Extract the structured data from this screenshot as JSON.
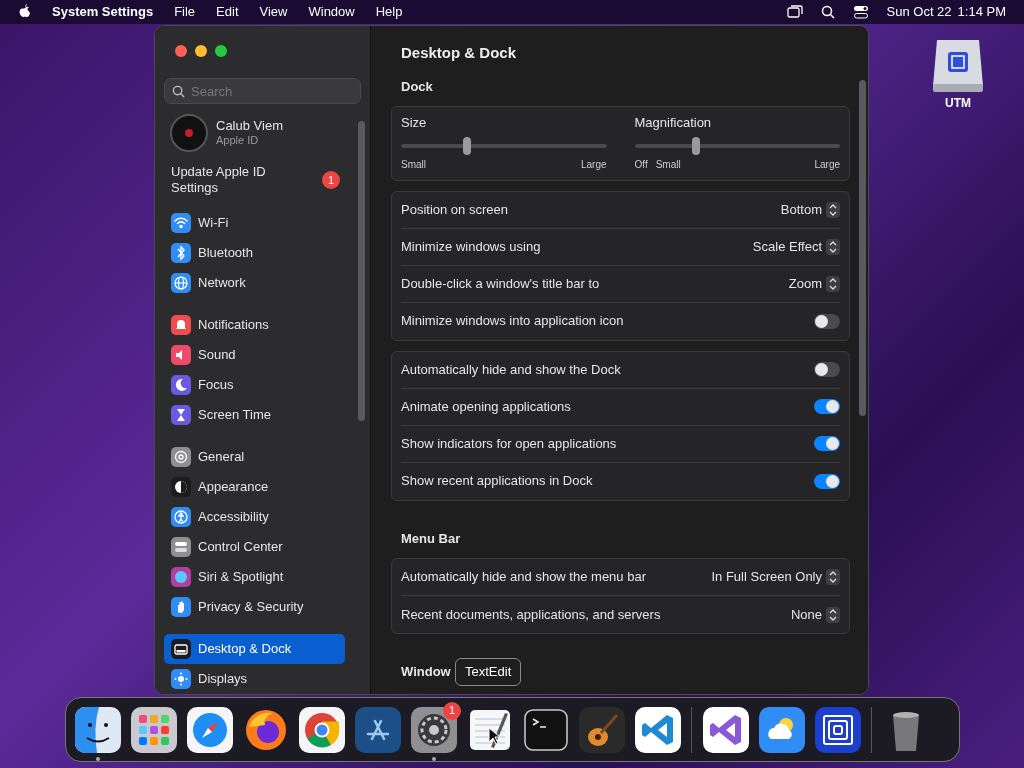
{
  "menu_bar": {
    "app_name": "System Settings",
    "menus": [
      "File",
      "Edit",
      "View",
      "Window",
      "Help"
    ],
    "date": "Sun Oct 22",
    "time": "1:14 PM"
  },
  "desktop_icon": {
    "label": "UTM"
  },
  "window": {
    "title": "Desktop & Dock",
    "sidebar": {
      "search": {
        "placeholder": "Search"
      },
      "account": {
        "name": "Calub Viem",
        "subtitle": "Apple ID"
      },
      "notice": {
        "text": "Update Apple ID Settings",
        "badge": "1"
      },
      "groups": [
        [
          {
            "label": "Wi-Fi",
            "selected": false
          },
          {
            "label": "Bluetooth",
            "selected": false
          },
          {
            "label": "Network",
            "selected": false
          }
        ],
        [
          {
            "label": "Notifications",
            "selected": false
          },
          {
            "label": "Sound",
            "selected": false
          },
          {
            "label": "Focus",
            "selected": false
          },
          {
            "label": "Screen Time",
            "selected": false
          }
        ],
        [
          {
            "label": "General",
            "selected": false
          },
          {
            "label": "Appearance",
            "selected": false
          },
          {
            "label": "Accessibility",
            "selected": false
          },
          {
            "label": "Control Center",
            "selected": false
          },
          {
            "label": "Siri & Spotlight",
            "selected": false
          },
          {
            "label": "Privacy & Security",
            "selected": false
          }
        ],
        [
          {
            "label": "Desktop & Dock",
            "selected": true
          },
          {
            "label": "Displays",
            "selected": false
          }
        ]
      ]
    },
    "sections": [
      {
        "title": "Dock",
        "sliders": [
          {
            "label": "Size",
            "level": 0.32,
            "ticks": [
              "Small",
              "Large"
            ]
          },
          {
            "label": "Magnification",
            "level": 0.3,
            "ticks": [
              "Small",
              "Large"
            ],
            "off_label": "Off"
          }
        ],
        "cards": [
          [
            {
              "kind": "select",
              "label": "Position on screen",
              "value": "Bottom"
            },
            {
              "kind": "select",
              "label": "Minimize windows using",
              "value": "Scale Effect"
            },
            {
              "kind": "select",
              "label": "Double-click a window's title bar to",
              "value": "Zoom"
            },
            {
              "kind": "toggle",
              "label": "Minimize windows into application icon",
              "on": false
            }
          ],
          [
            {
              "kind": "toggle",
              "label": "Automatically hide and show the Dock",
              "on": false
            },
            {
              "kind": "toggle",
              "label": "Animate opening applications",
              "on": true
            },
            {
              "kind": "toggle",
              "label": "Show indicators for open applications",
              "on": true
            },
            {
              "kind": "toggle",
              "label": "Show recent applications in Dock",
              "on": true
            }
          ]
        ]
      },
      {
        "title": "Menu Bar",
        "cards": [
          [
            {
              "kind": "select",
              "label": "Automatically hide and show the menu bar",
              "value": "In Full Screen Only"
            },
            {
              "kind": "select",
              "label": "Recent documents, applications, and servers",
              "value": "None"
            }
          ]
        ]
      },
      {
        "title": "Window"
      }
    ]
  },
  "dock": {
    "tooltip": "TextEdit",
    "groups": [
      [
        {
          "kind": "finder",
          "running": true
        },
        {
          "kind": "launchpad",
          "running": false
        },
        {
          "kind": "safari",
          "running": false
        },
        {
          "kind": "firefox",
          "running": false
        },
        {
          "kind": "chrome",
          "running": false
        },
        {
          "kind": "appstore",
          "running": false
        },
        {
          "kind": "settings",
          "running": true,
          "badge": "1"
        },
        {
          "kind": "textedit",
          "running": false
        },
        {
          "kind": "terminal",
          "running": false
        },
        {
          "kind": "garageband",
          "running": false
        },
        {
          "kind": "vscode",
          "running": false
        }
      ],
      [
        {
          "kind": "vstudio",
          "running": false
        },
        {
          "kind": "weather",
          "running": false
        },
        {
          "kind": "utm",
          "running": false
        }
      ],
      [
        {
          "kind": "trash",
          "running": false
        }
      ]
    ]
  }
}
